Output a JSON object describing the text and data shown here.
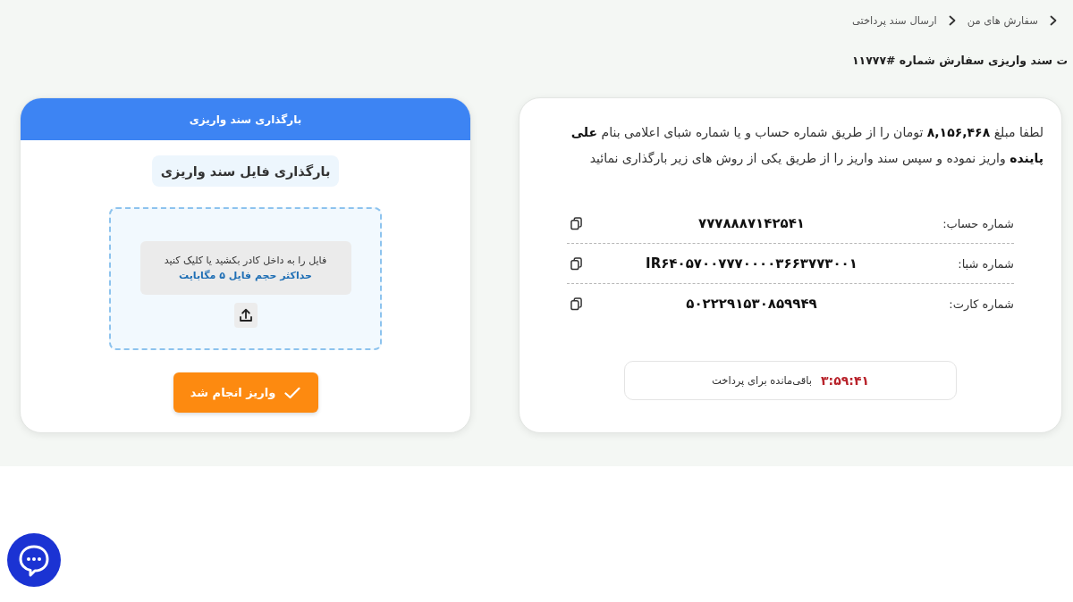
{
  "breadcrumb": {
    "items": [
      {
        "label": "سفارش های من"
      },
      {
        "label": "ارسال سند پرداختی"
      }
    ]
  },
  "page_title": "ت سند واریزی سفارش شماره #۱۱۷۷۷",
  "payment_info": {
    "instructions": "لطفا مبلغ **۸,۱۵۶,۴۶۸** تومان را از طریق شماره حساب و یا شماره شبای اعلامی بنام **علی پاینده** واریز نموده و سپس سند واریز را از طریق یکی از روش های زیر بارگذاری نمائید",
    "accounts": [
      {
        "label": "شماره حساب:",
        "value": "۷۷۷۸۸۸۷۱۴۲۵۴۱"
      },
      {
        "label": "شماره شبا:",
        "value": "IR۶۴۰۵۷۰۰۷۷۷۰۰۰۰۳۶۶۳۷۷۳۰۰۱"
      },
      {
        "label": "شماره کارت:",
        "value": "۵۰۲۲۲۹۱۵۳۰۸۵۹۹۴۹"
      }
    ],
    "timer": {
      "time": "۳:۵۹:۴۱",
      "label": "باقی‌مانده برای پرداخت"
    }
  },
  "upload": {
    "header": "بارگذاری سند واریزی",
    "title": "بارگذاری فایل سند واریزی",
    "dropzone": {
      "hint": "فایل را به داخل کادر بکشید یا کلیک کنید",
      "limit": "حداکثر حجم فایل ۵ مگابایت"
    },
    "submit_button": "واریز انجام شد"
  }
}
